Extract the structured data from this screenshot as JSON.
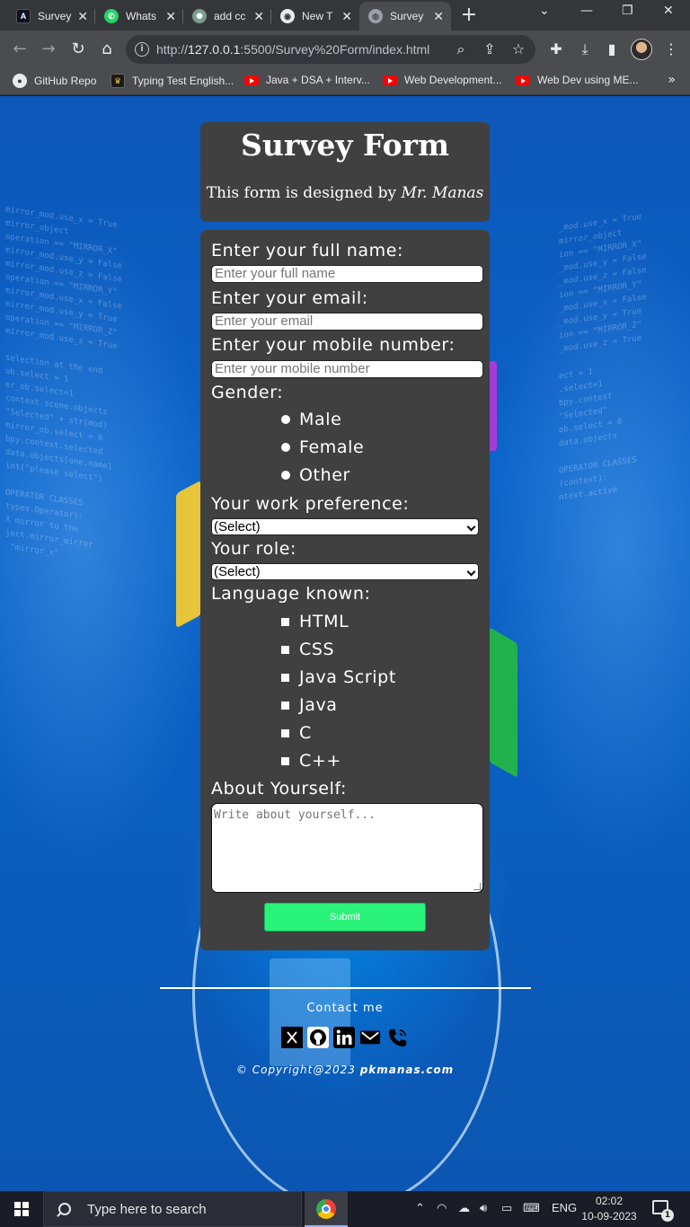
{
  "browser": {
    "tabs": [
      {
        "title": "Survey",
        "icon": "angular-icon"
      },
      {
        "title": "Whats",
        "icon": "whatsapp-icon"
      },
      {
        "title": "add cc",
        "icon": "openai-icon"
      },
      {
        "title": "New T",
        "icon": "chrome-icon"
      },
      {
        "title": "Survey",
        "icon": "globe-icon",
        "active": true
      }
    ],
    "address": {
      "prefix": "http://",
      "host": "127.0.0.1",
      "rest": ":5500/Survey%20Form/index.html"
    },
    "bookmarks": [
      {
        "label": "GitHub Repo",
        "icon": "github-icon"
      },
      {
        "label": "Typing Test English...",
        "icon": "typing-icon"
      },
      {
        "label": "Java + DSA + Interv...",
        "icon": "youtube-icon"
      },
      {
        "label": "Web Development...",
        "icon": "youtube-icon"
      },
      {
        "label": "Web Dev using ME...",
        "icon": "youtube-icon"
      }
    ]
  },
  "header": {
    "title": "Survey Form",
    "byline_prefix": "This form is designed by ",
    "author": "Mr. Manas"
  },
  "form": {
    "name_label": "Enter your full name:",
    "name_placeholder": "Enter your full name",
    "email_label": "Enter your email:",
    "email_placeholder": "Enter your email",
    "mobile_label": "Enter your mobile number:",
    "mobile_placeholder": "Enter your mobile number",
    "gender_label": "Gender:",
    "gender_options": [
      "Male",
      "Female",
      "Other"
    ],
    "work_label": "Your work preference:",
    "work_value": "(Select)",
    "role_label": "Your role:",
    "role_value": "(Select)",
    "languages_label": "Language known:",
    "languages": [
      "HTML",
      "CSS",
      "Java Script",
      "Java",
      "C",
      "C++"
    ],
    "about_label": "About Yourself:",
    "about_placeholder": "Write about yourself...",
    "submit_label": "Submit"
  },
  "footer": {
    "contact_label": "Contact me",
    "social_icons": [
      "x-icon",
      "github-icon",
      "linkedin-icon",
      "gmail-icon",
      "phone-icon"
    ],
    "copyright_prefix": "© Copyright@2023 ",
    "copyright_site": "pkmanas.com"
  },
  "taskbar": {
    "search_placeholder": "Type here to search",
    "language": "ENG",
    "time": "02:02",
    "date": "10-09-2023",
    "notification_count": "1"
  },
  "colors": {
    "card_bg": "#404040",
    "submit_bg": "#29f37a",
    "page_bg": "#0b63c9"
  }
}
